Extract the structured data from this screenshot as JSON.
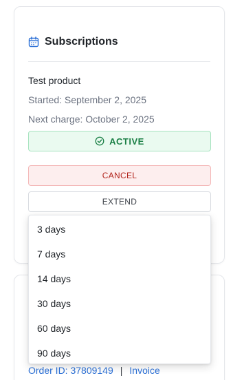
{
  "subscription_card": {
    "icon": "calendar-icon",
    "title": "Subscriptions",
    "product_name": "Test product",
    "started": "Started: September 2, 2025",
    "next_charge": "Next charge: October 2, 2025",
    "status": {
      "icon": "check-circle-icon",
      "label": "ACTIVE"
    },
    "cancel_label": "CANCEL",
    "extend_label": "EXTEND"
  },
  "order_card": {
    "order_id": "Order ID: 37809149",
    "separator": "|",
    "invoice_label": "Invoice"
  },
  "extend_dropdown": {
    "options": [
      "3 days",
      "7 days",
      "14 days",
      "30 days",
      "60 days",
      "90 days"
    ]
  },
  "colors": {
    "accent_blue": "#2a6fd6",
    "active_green": "#1a7f45",
    "active_bg": "#eafaf0",
    "cancel_red": "#b3261e",
    "cancel_bg": "#fdeeee"
  }
}
